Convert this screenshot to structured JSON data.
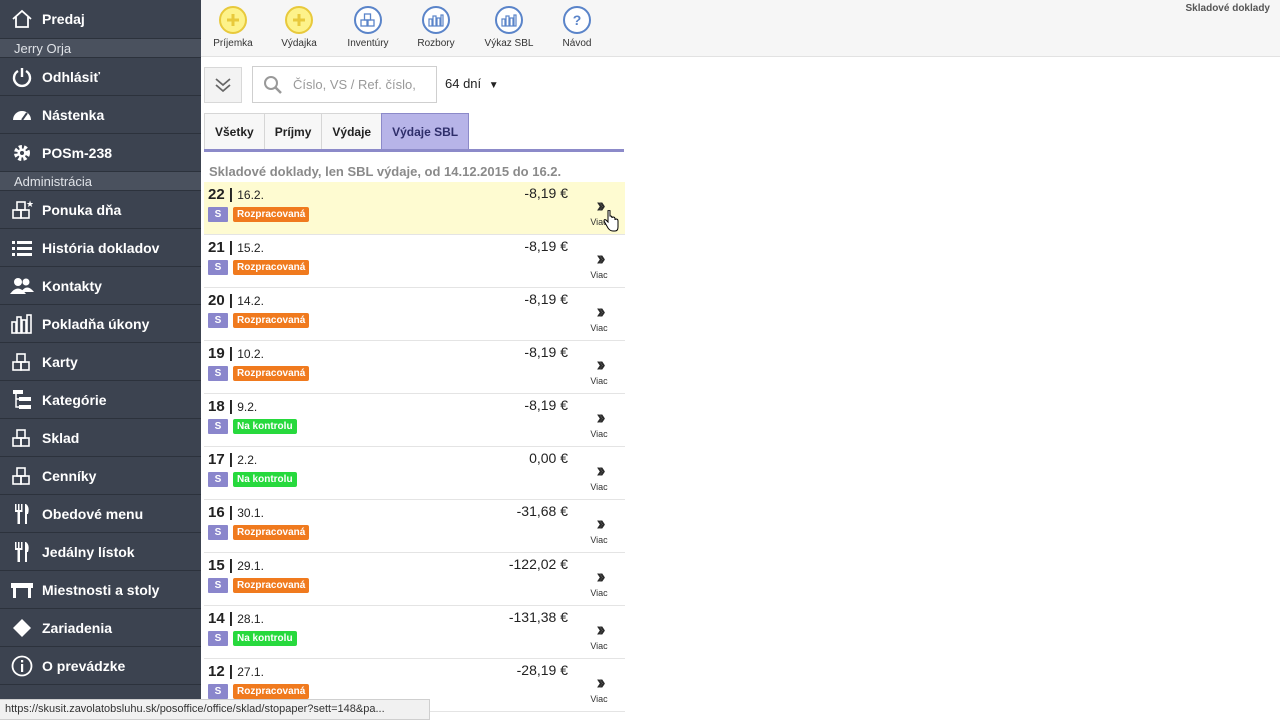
{
  "sidebar": {
    "predaj": "Predaj",
    "user": "Jerry Orja",
    "logout": "Odhlásiť",
    "dashboard": "Nástenka",
    "pos": "POSm-238",
    "admin_section": "Administrácia",
    "items": [
      {
        "label": "Ponuka dňa",
        "icon": "daily-offer-icon"
      },
      {
        "label": "História dokladov",
        "icon": "list-icon"
      },
      {
        "label": "Kontakty",
        "icon": "contacts-icon"
      },
      {
        "label": "Pokladňa úkony",
        "icon": "bar-chart-icon"
      },
      {
        "label": "Karty",
        "icon": "cards-icon"
      },
      {
        "label": "Kategórie",
        "icon": "categories-icon"
      },
      {
        "label": "Sklad",
        "icon": "warehouse-icon"
      },
      {
        "label": "Cenníky",
        "icon": "pricelist-icon"
      },
      {
        "label": "Obedové menu",
        "icon": "cutlery-icon"
      },
      {
        "label": "Jedálny lístok",
        "icon": "cutlery-icon"
      },
      {
        "label": "Miestnosti a stoly",
        "icon": "table-icon"
      },
      {
        "label": "Zariadenia",
        "icon": "diamond-icon"
      },
      {
        "label": "O prevádzke",
        "icon": "info-icon"
      }
    ]
  },
  "toolbar": {
    "page_title": "Skladové doklady",
    "buttons": [
      {
        "label": "Príjemka",
        "icon": "plus-icon"
      },
      {
        "label": "Výdajka",
        "icon": "plus-icon"
      },
      {
        "label": "Inventúry",
        "icon": "boxes-icon"
      },
      {
        "label": "Rozbory",
        "icon": "bar-chart-icon"
      },
      {
        "label": "Výkaz SBL",
        "icon": "bar-chart-icon"
      },
      {
        "label": "Návod",
        "icon": "help-icon"
      }
    ]
  },
  "filter": {
    "search_placeholder": "Číslo, VS / Ref. číslo,",
    "days": "64 dní"
  },
  "tabs": [
    {
      "label": "Všetky",
      "active": false
    },
    {
      "label": "Príjmy",
      "active": false
    },
    {
      "label": "Výdaje",
      "active": false
    },
    {
      "label": "Výdaje SBL",
      "active": true
    }
  ],
  "list_title": "Skladové doklady, len SBL výdaje, od 14.12.2015 do 16.2.",
  "more_label": "Viac",
  "rows": [
    {
      "num": "22",
      "date": "16.2.",
      "amount": "-8,19 €",
      "type": "S",
      "status": "Rozpracovaná",
      "status_color": "#f07a1e",
      "highlight": true
    },
    {
      "num": "21",
      "date": "15.2.",
      "amount": "-8,19 €",
      "type": "S",
      "status": "Rozpracovaná",
      "status_color": "#f07a1e",
      "highlight": false
    },
    {
      "num": "20",
      "date": "14.2.",
      "amount": "-8,19 €",
      "type": "S",
      "status": "Rozpracovaná",
      "status_color": "#f07a1e",
      "highlight": false
    },
    {
      "num": "19",
      "date": "10.2.",
      "amount": "-8,19 €",
      "type": "S",
      "status": "Rozpracovaná",
      "status_color": "#f07a1e",
      "highlight": false
    },
    {
      "num": "18",
      "date": "9.2.",
      "amount": "-8,19 €",
      "type": "S",
      "status": "Na kontrolu",
      "status_color": "#27d93d",
      "highlight": false
    },
    {
      "num": "17",
      "date": "2.2.",
      "amount": "0,00 €",
      "type": "S",
      "status": "Na kontrolu",
      "status_color": "#27d93d",
      "highlight": false
    },
    {
      "num": "16",
      "date": "30.1.",
      "amount": "-31,68 €",
      "type": "S",
      "status": "Rozpracovaná",
      "status_color": "#f07a1e",
      "highlight": false
    },
    {
      "num": "15",
      "date": "29.1.",
      "amount": "-122,02 €",
      "type": "S",
      "status": "Rozpracovaná",
      "status_color": "#f07a1e",
      "highlight": false
    },
    {
      "num": "14",
      "date": "28.1.",
      "amount": "-131,38 €",
      "type": "S",
      "status": "Na kontrolu",
      "status_color": "#27d93d",
      "highlight": false
    },
    {
      "num": "12",
      "date": "27.1.",
      "amount": "-28,19 €",
      "type": "S",
      "status": "Rozpracovaná",
      "status_color": "#f07a1e",
      "highlight": false
    }
  ],
  "status_url": "https://skusit.zavolatobsluhu.sk/posoffice/office/sklad/stopaper?sett=148&pa..."
}
